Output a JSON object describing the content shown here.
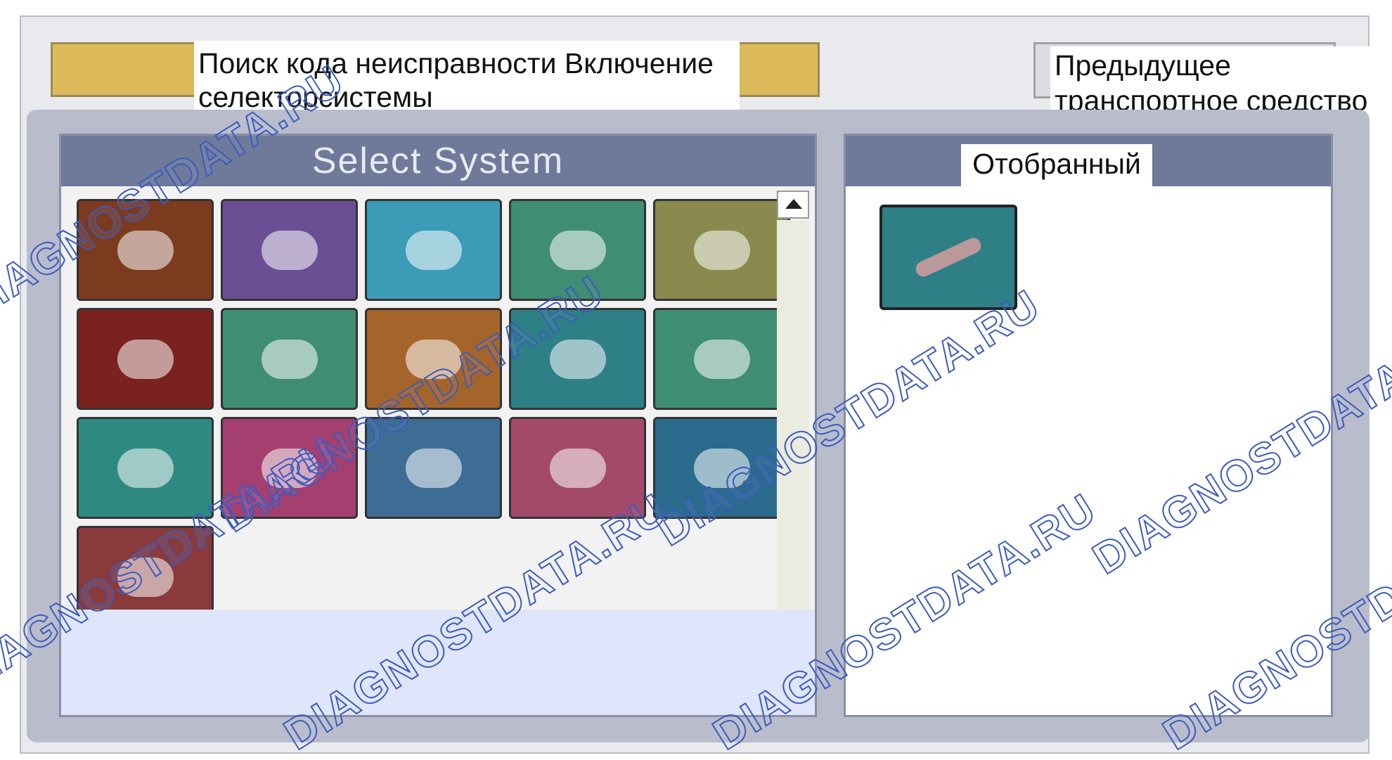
{
  "toolbar": {
    "dtc_search_label": "Поиск кода неисправности Включение селекторсистемы",
    "prev_vehicle_label": "Предыдущее транспортное средство"
  },
  "select_panel": {
    "title": "Select System",
    "tiles": [
      {
        "name": "engine-system-tile",
        "color": "#7c3a1f"
      },
      {
        "name": "transmission-system-tile",
        "color": "#6a4f94"
      },
      {
        "name": "steering-system-tile",
        "color": "#3c9cb8"
      },
      {
        "name": "brake-system-tile",
        "color": "#3f8d72"
      },
      {
        "name": "restraint-system-tile",
        "color": "#8a8a4f"
      },
      {
        "name": "chassis-system-tile",
        "color": "#7a2220"
      },
      {
        "name": "body-system-tile",
        "color": "#3f8d72"
      },
      {
        "name": "hvac-system-tile",
        "color": "#a5652a"
      },
      {
        "name": "electrical-system-tile",
        "color": "#2e7f86"
      },
      {
        "name": "network-system-tile",
        "color": "#3f8d72"
      },
      {
        "name": "lighting-system-tile",
        "color": "#2e8a80"
      },
      {
        "name": "security-system-tile",
        "color": "#a43f70"
      },
      {
        "name": "instrument-system-tile",
        "color": "#3d6d94"
      },
      {
        "name": "audio-system-tile",
        "color": "#a34a6a"
      },
      {
        "name": "climate-system-tile",
        "color": "#2b6b8d"
      },
      {
        "name": "accessory-system-tile",
        "color": "#8a3a3a"
      }
    ]
  },
  "selected_panel": {
    "title": "Отобранный",
    "tile_color": "#2e7f86"
  },
  "watermarks": [
    "DIAGNOSTDATA.RU",
    "DIAGNOSTDATA.RU",
    "DIAGNOSTDATA.RU",
    "DIAGNOSTDATA.RU",
    "DIAGNOSTDATA.RU",
    "DIAGNOSTDATA.RU",
    "DIAGNOSTDATA.RU",
    "DIAGNOSTDATA.RU"
  ],
  "colors": {
    "header_bar": "#6f7a9a",
    "gold_button": "#ddb95a"
  }
}
